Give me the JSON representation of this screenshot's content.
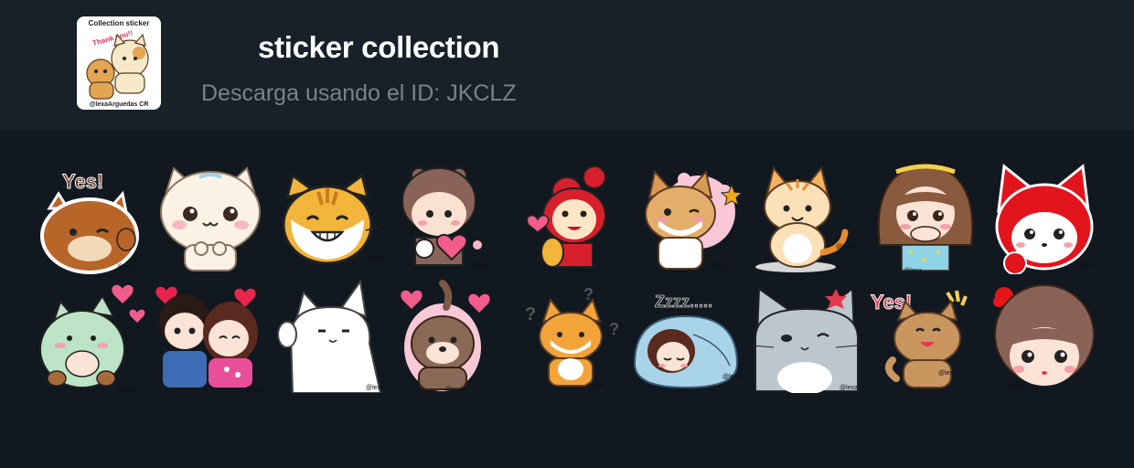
{
  "pack": {
    "title": "sticker collection",
    "subtitle": "Descarga usando el ID: JKCLZ",
    "icon": {
      "top_text": "Collection sticker",
      "middle_text": "Thank you!!",
      "bottom_text": "@lexaArguedas CR"
    }
  },
  "watermark": "@lexa",
  "stickers_row1": [
    {
      "name": "yes-fox",
      "caption": "Yes!"
    },
    {
      "name": "cream-cat"
    },
    {
      "name": "orange-cat"
    },
    {
      "name": "girl-heart"
    },
    {
      "name": "red-monkey"
    },
    {
      "name": "corgi"
    },
    {
      "name": "sitting-cat"
    },
    {
      "name": "shy-girl"
    },
    {
      "name": "red-fox"
    }
  ],
  "stickers_row2": [
    {
      "name": "green-dino"
    },
    {
      "name": "couple"
    },
    {
      "name": "white-cat"
    },
    {
      "name": "otter"
    },
    {
      "name": "shiba"
    },
    {
      "name": "sleeping-girl",
      "caption": "Zzzz....."
    },
    {
      "name": "gray-cat"
    },
    {
      "name": "yes-cat",
      "caption": "Yes!"
    },
    {
      "name": "girl-bob"
    }
  ]
}
